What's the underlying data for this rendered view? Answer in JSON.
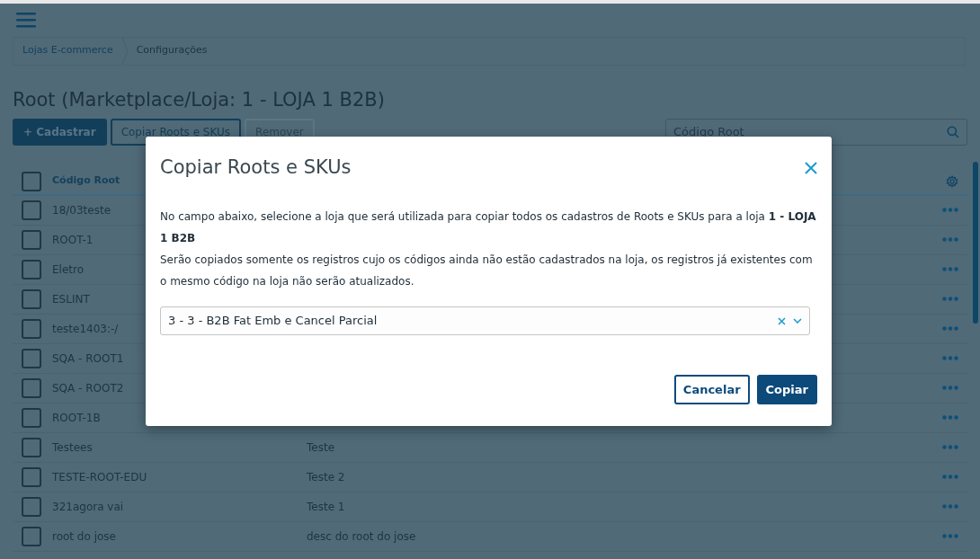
{
  "breadcrumb": [
    {
      "label": "Lojas E-commerce",
      "selected": false
    },
    {
      "label": "Configurações",
      "selected": true
    }
  ],
  "page_title": "Root (Marketplace/Loja: 1 - LOJA 1 B2B)",
  "actions": [
    {
      "label": "+ Cadastrar",
      "kind": "primary",
      "disabled": false
    },
    {
      "label": "Copiar Roots e SKUs",
      "kind": "outline",
      "disabled": false
    },
    {
      "label": "Remover",
      "kind": "outline",
      "disabled": true
    }
  ],
  "search": {
    "placeholder": "Código Root"
  },
  "table": {
    "header_checked": false,
    "columns": [
      "Código Root"
    ],
    "rows": [
      {
        "code": "18/03teste",
        "checked": false
      },
      {
        "code": "ROOT-1",
        "checked": false
      },
      {
        "code": "Eletro",
        "checked": false
      },
      {
        "code": "ESLINT",
        "checked": false
      },
      {
        "code": "teste1403:-/",
        "checked": false
      },
      {
        "code": "SQA - ROOT1",
        "checked": false
      },
      {
        "code": "SQA - ROOT2",
        "checked": false
      },
      {
        "code": "ROOT-1B",
        "checked": false
      },
      {
        "code": "Testees",
        "description": "Teste",
        "checked": false
      },
      {
        "code": "TESTE-ROOT-EDU",
        "description": "Teste 2",
        "checked": false
      },
      {
        "code": "321agora vai",
        "description": "Teste 1",
        "checked": false
      },
      {
        "code": "root do jose",
        "description": "desc do root do jose",
        "checked": false
      }
    ]
  },
  "modal": {
    "title": "Copiar Roots e SKUs",
    "paragraphs": [
      "No campo abaixo, selecione a loja que será utilizada para copiar todos os cadastros de Roots e SKUs para a loja **1 - LOJA 1 B2B**",
      "Serão copiados somente os registros cujo os códigos ainda não estão cadastrados na loja, os registros já existentes com o mesmo código na loja não serão atualizados."
    ],
    "select_value": "3 - 3 - B2B Fat Emb e Cancel Parcial",
    "buttons": [
      {
        "label": "Cancelar",
        "kind": "outline"
      },
      {
        "label": "Copiar",
        "kind": "primary"
      }
    ]
  }
}
